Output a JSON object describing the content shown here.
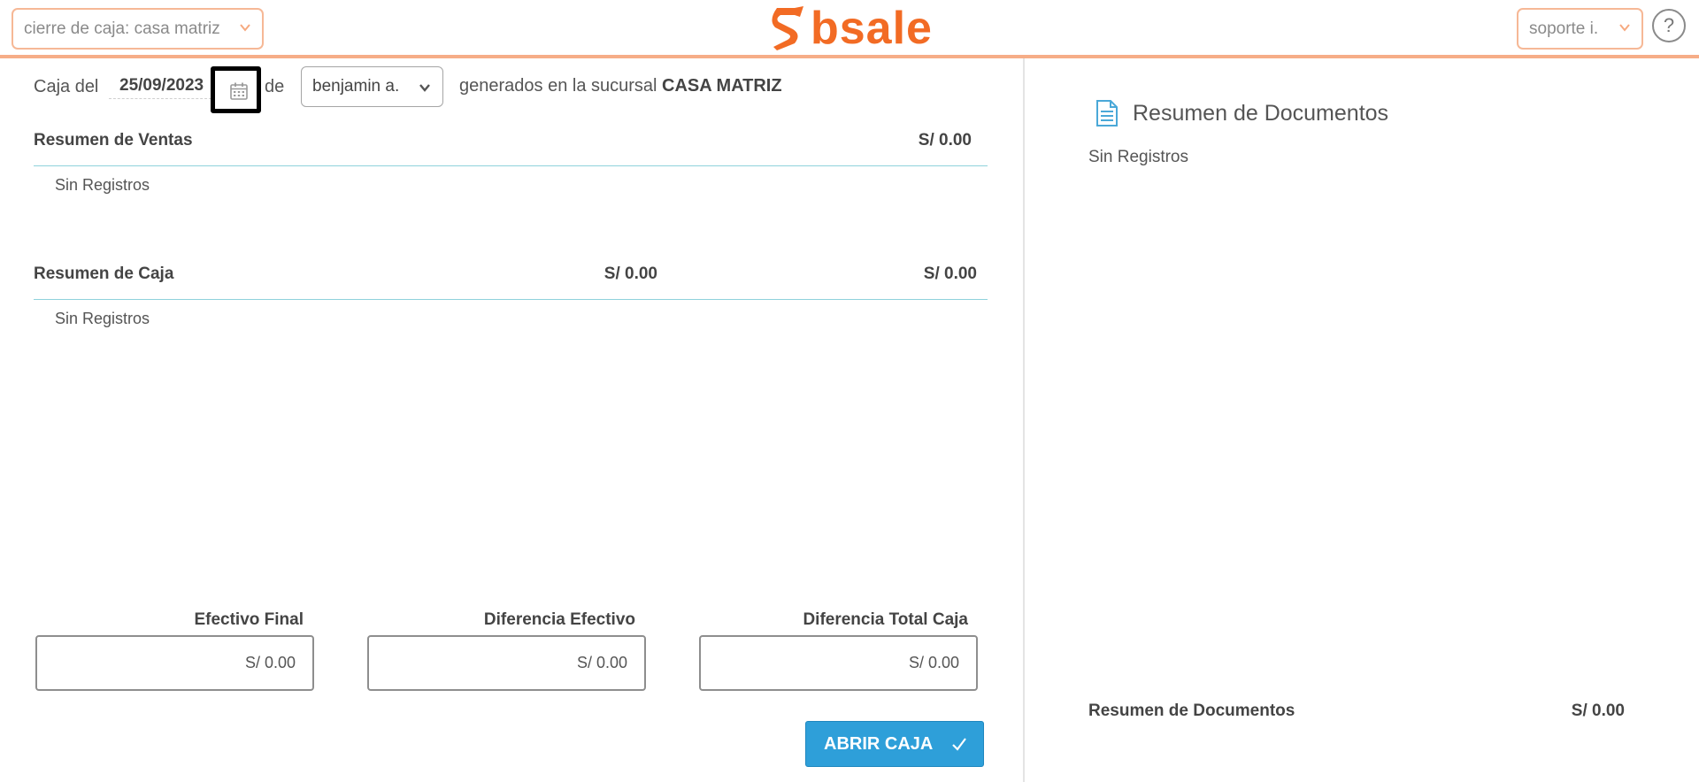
{
  "header": {
    "module_select": "cierre de caja: casa matriz",
    "logo_text": "bsale",
    "user_select": "soporte i.",
    "help_label": "?"
  },
  "filters": {
    "caja_del_label": "Caja del",
    "date_value": "25/09/2023",
    "de_label": "de",
    "cashier_value": "benjamin a.",
    "branch_prefix": "generados en la sucursal",
    "branch_name": "CASA MATRIZ"
  },
  "ventas": {
    "title": "Resumen de Ventas",
    "total": "S/ 0.00",
    "empty": "Sin Registros"
  },
  "caja": {
    "title": "Resumen de Caja",
    "total_a": "S/ 0.00",
    "total_b": "S/ 0.00",
    "empty": "Sin Registros"
  },
  "totals": [
    {
      "label": "Efectivo Final",
      "value": "S/ 0.00"
    },
    {
      "label": "Diferencia Efectivo",
      "value": "S/ 0.00"
    },
    {
      "label": "Diferencia Total Caja",
      "value": "S/ 0.00"
    }
  ],
  "actions": {
    "open_cash_label": "ABRIR CAJA"
  },
  "documents": {
    "title": "Resumen de Documentos",
    "empty": "Sin Registros",
    "footer_label": "Resumen de Documentos",
    "footer_total": "S/ 0.00"
  },
  "colors": {
    "brand": "#f26b24",
    "accent_line": "#8fd2dc",
    "button": "#2e9fd9",
    "icon_blue": "#4aa8d8"
  },
  "icons": {
    "logo": "bsale-s-logo-icon",
    "calendar": "calendar-icon",
    "chevron": "chevron-down-icon",
    "document": "document-icon",
    "check": "check-icon",
    "help": "help-icon"
  }
}
